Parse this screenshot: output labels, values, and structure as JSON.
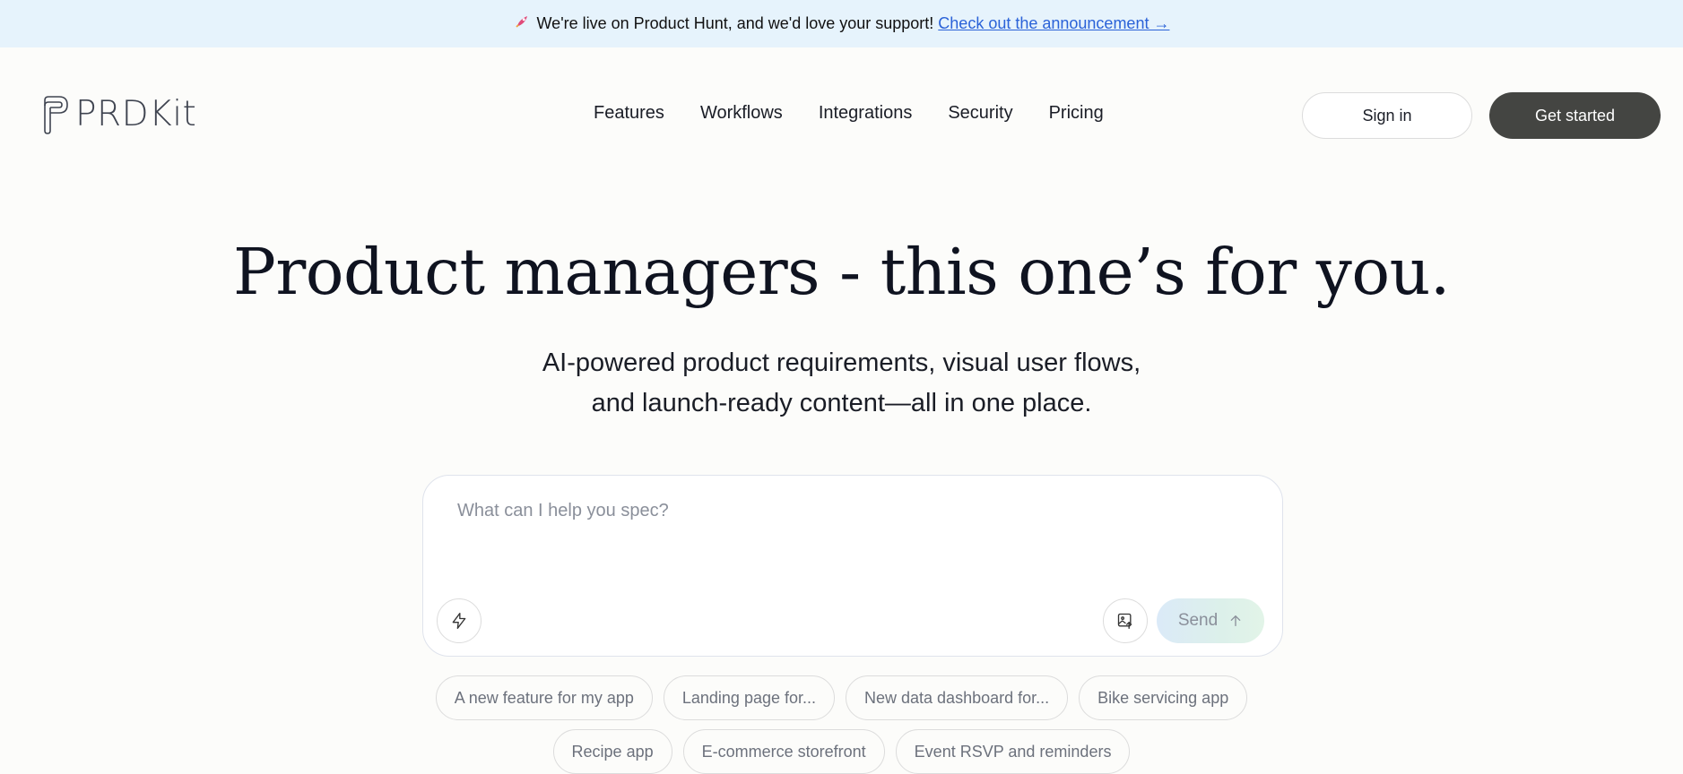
{
  "banner": {
    "rocket_icon": "rocket-icon",
    "text": "We're live on Product Hunt, and we'd love your support!",
    "link": "Check out the announcement →"
  },
  "nav": {
    "logo_text": "PRDKit",
    "links": [
      "Features",
      "Workflows",
      "Integrations",
      "Security",
      "Pricing"
    ],
    "sign_in": "Sign in",
    "get_started": "Get started"
  },
  "hero": {
    "title": "Product managers - this one’s for you.",
    "subtitle_line1": "AI-powered product requirements, visual user flows,",
    "subtitle_line2": "and launch-ready content—all in one place."
  },
  "prompt": {
    "placeholder": "What can I help you spec?",
    "send_label": "Send"
  },
  "suggestions": {
    "row1": [
      "A new feature for my app",
      "Landing page for...",
      "New data dashboard for...",
      "Bike servicing app"
    ],
    "row2": [
      "Recipe app",
      "E-commerce storefront",
      "Event RSVP and reminders"
    ]
  },
  "colors": {
    "banner_bg": "#e6f3fc",
    "primary_button": "#444542",
    "link": "#2a62d8"
  }
}
